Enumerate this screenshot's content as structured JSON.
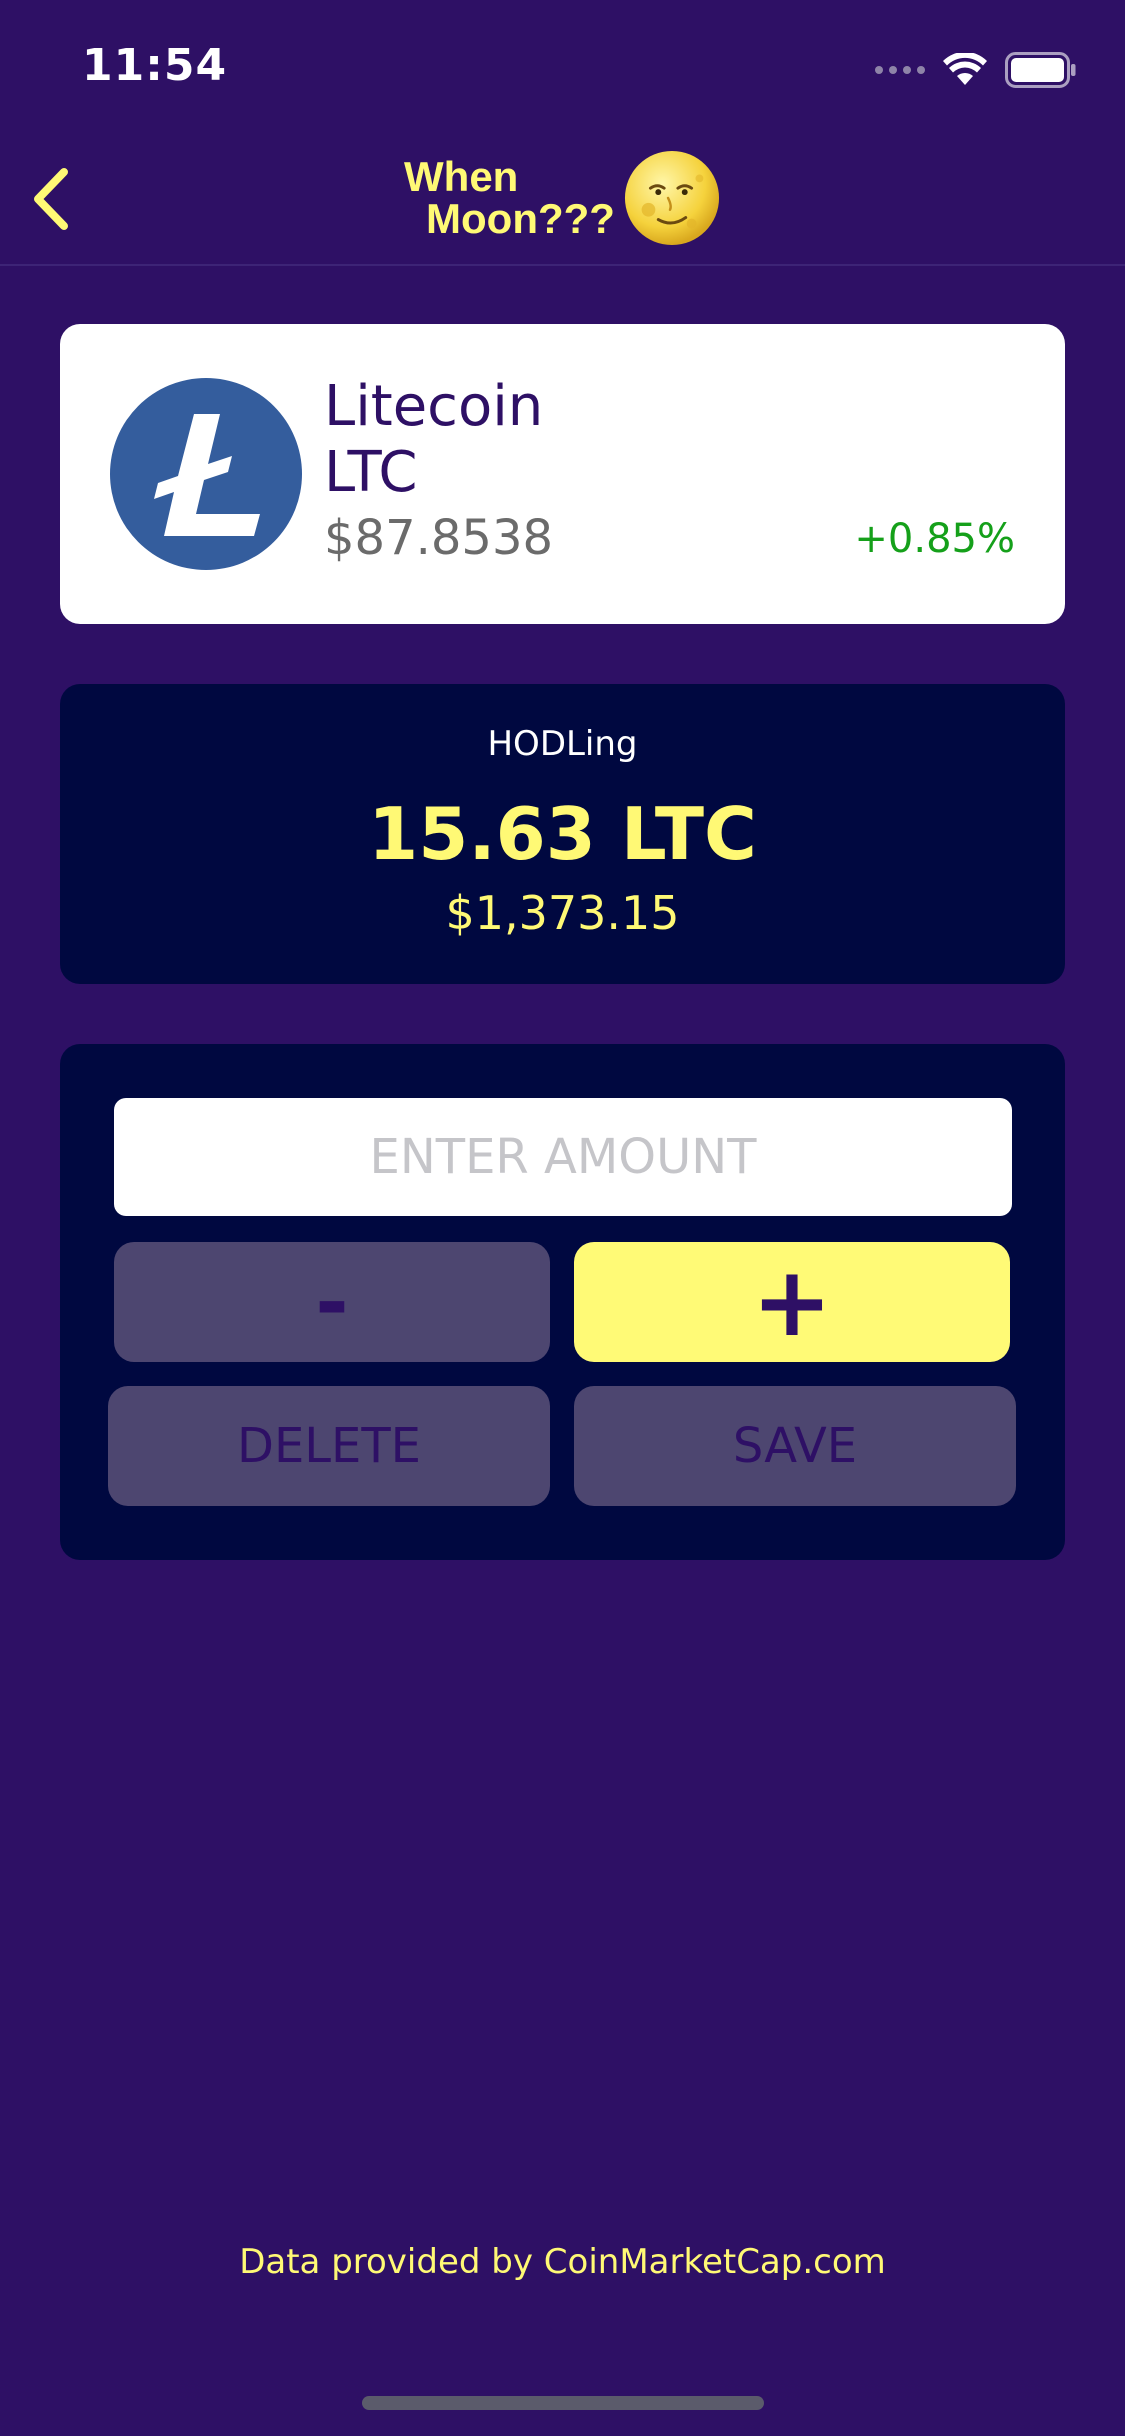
{
  "status_bar": {
    "time": "11:54"
  },
  "nav": {
    "title_line1": "When",
    "title_line2": "Moon???",
    "icon": "full-moon-face-icon",
    "back_icon": "chevron-left-icon"
  },
  "coin": {
    "name": "Litecoin",
    "symbol": "LTC",
    "price": "$87.8538",
    "change": "+0.85%",
    "logo_icon": "litecoin-logo-icon"
  },
  "holdings": {
    "label": "HODLing",
    "amount": "15.63 LTC",
    "value": "$1,373.15"
  },
  "editor": {
    "amount_placeholder": "ENTER AMOUNT",
    "amount_value": "",
    "minus_label": "-",
    "plus_label": "+",
    "delete_label": "DELETE",
    "save_label": "SAVE"
  },
  "footer": {
    "credit": "Data provided by CoinMarketCap.com"
  },
  "colors": {
    "background": "#2e1065",
    "accent_yellow": "#fff975",
    "card_dark": "#000840",
    "positive_green": "#15a01a",
    "disabled_button": "#4d4670"
  }
}
